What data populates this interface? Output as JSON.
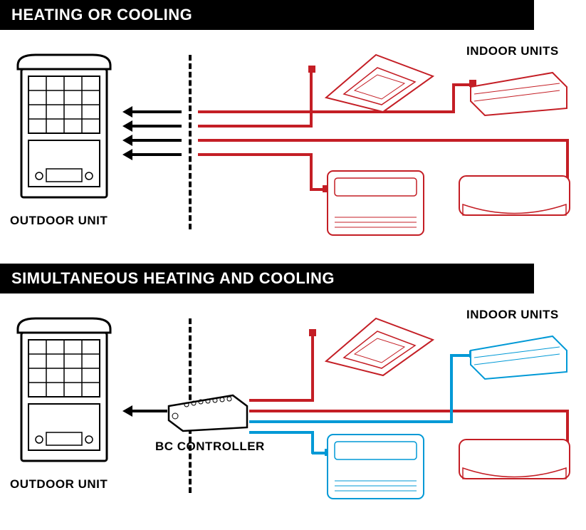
{
  "section1": {
    "title": "HEATING OR COOLING",
    "outdoor_label": "OUTDOOR UNIT",
    "indoor_label": "INDOOR UNITS"
  },
  "section2": {
    "title": "SIMULTANEOUS HEATING AND COOLING",
    "outdoor_label": "OUTDOOR UNIT",
    "indoor_label": "INDOOR UNITS",
    "bc_label": "BC CONTROLLER"
  },
  "colors": {
    "heat": "#c41e25",
    "cool": "#0099d6",
    "black": "#000000"
  }
}
